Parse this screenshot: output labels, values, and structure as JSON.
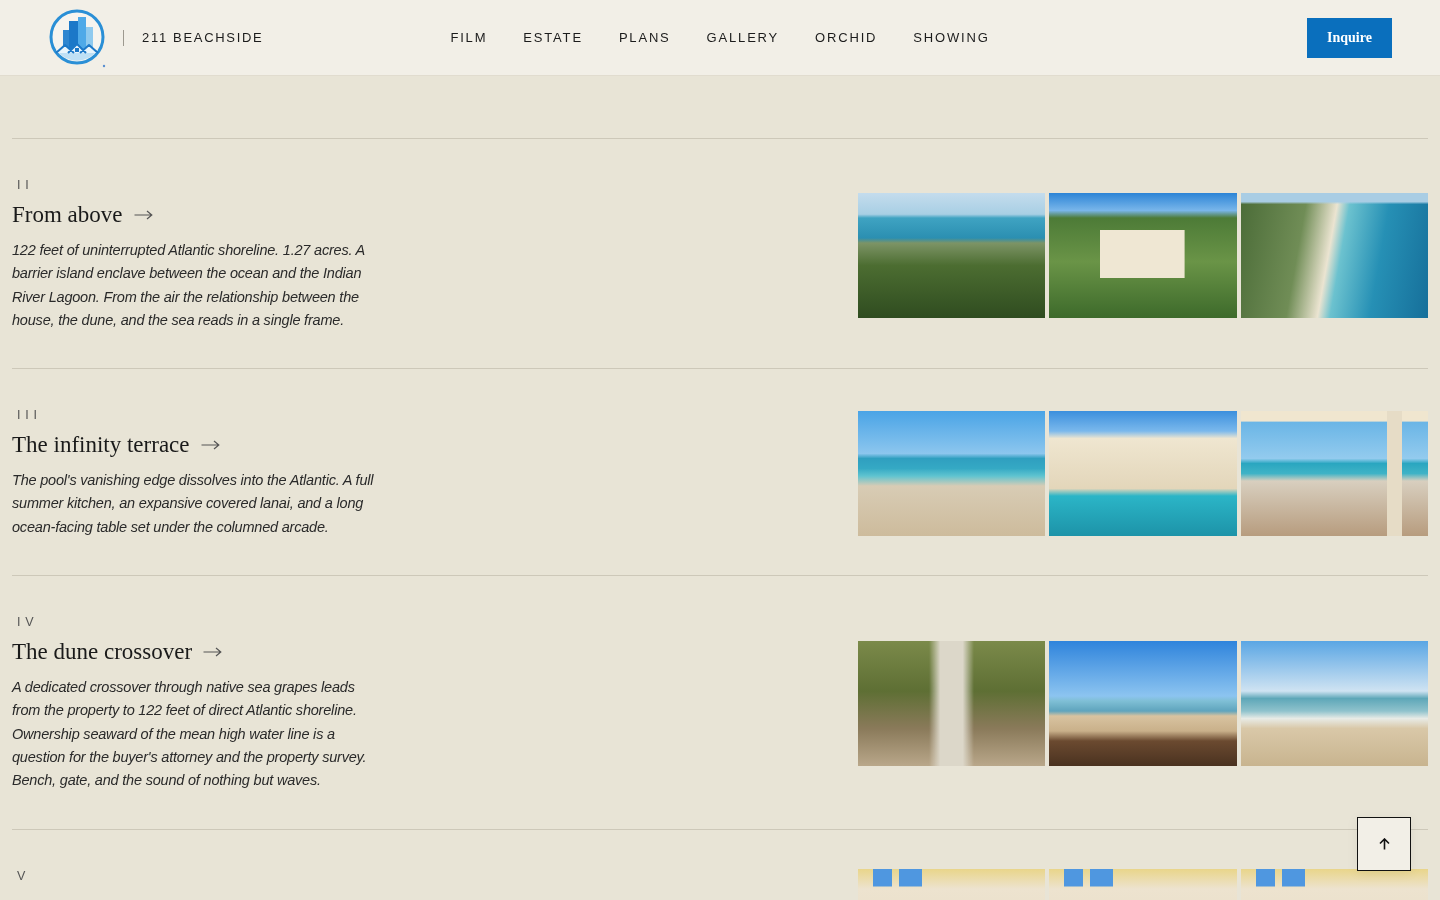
{
  "header": {
    "brand": "211 BEACHSIDE",
    "nav": [
      "FILM",
      "ESTATE",
      "PLANS",
      "GALLERY",
      "ORCHID",
      "SHOWING"
    ],
    "cta": "Inquire"
  },
  "sections": [
    {
      "numeral": "II",
      "heading": "From above",
      "text": "122 feet of uninterrupted Atlantic shoreline. 1.27 acres. A barrier island enclave between the ocean and the Indian River Lagoon. From the air the relationship between the house, the dune, and the sea reads in a single frame.",
      "photos": [
        {
          "kind": "coast"
        },
        {
          "kind": "estate"
        },
        {
          "kind": "shoreline"
        }
      ]
    },
    {
      "numeral": "III",
      "heading": "The infinity terrace",
      "text": "The pool's vanishing edge dissolves into the Atlantic. A full summer kitchen, an expansive covered lanai, and a long ocean-facing table set under the columned arcade.",
      "photos": [
        {
          "kind": "pool"
        },
        {
          "kind": "villa-pool"
        },
        {
          "kind": "lanai"
        }
      ]
    },
    {
      "numeral": "IV",
      "heading": "The dune crossover",
      "text": "A dedicated crossover through native sea grapes leads from the property to 122 feet of direct Atlantic shoreline. Ownership seaward of the mean high water line is a question for the buyer's attorney and the property survey. Bench, gate, and the sound of nothing but waves.",
      "photos": [
        {
          "kind": "boardwalk"
        },
        {
          "kind": "stairs"
        },
        {
          "kind": "waves"
        }
      ]
    },
    {
      "numeral": "V",
      "photos": [
        {
          "kind": "interior"
        },
        {
          "kind": "interior"
        },
        {
          "kind": "interior"
        }
      ]
    }
  ]
}
